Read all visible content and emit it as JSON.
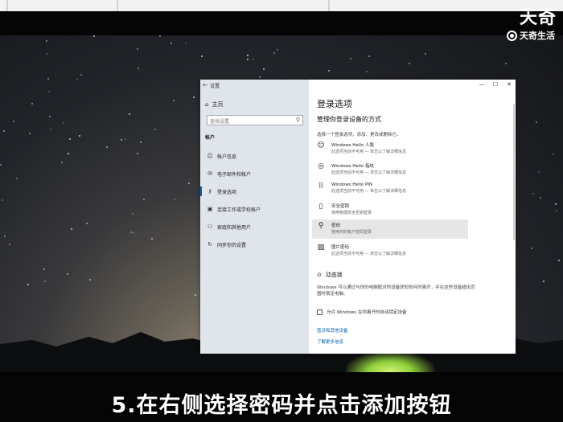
{
  "watermark": {
    "brand_large": "天奇",
    "brand_small": "天奇生活"
  },
  "window": {
    "title": "设置",
    "controls": {
      "minimize": "—",
      "maximize": "☐",
      "close": "✕"
    }
  },
  "sidebar": {
    "home_label": "主页",
    "search_placeholder": "查找设置",
    "section_title": "帐户",
    "items": [
      {
        "label": "帐户信息",
        "icon": "person-icon"
      },
      {
        "label": "电子邮件和帐户",
        "icon": "mail-icon"
      },
      {
        "label": "登录选项",
        "icon": "key-icon",
        "active": true
      },
      {
        "label": "连接工作或学校帐户",
        "icon": "briefcase-icon"
      },
      {
        "label": "家庭和其他用户",
        "icon": "people-icon"
      },
      {
        "label": "同步你的设置",
        "icon": "sync-icon"
      }
    ]
  },
  "content": {
    "title": "登录选项",
    "subtitle": "管理你登录设备的方式",
    "hint": "选择一个登录选项，添加、更改或删除它。",
    "options": [
      {
        "name": "Windows Hello 人脸",
        "desc": "此选项当前不可用 — 单击以了解详细信息",
        "icon": "face-icon"
      },
      {
        "name": "Windows Hello 指纹",
        "desc": "此选项当前不可用 — 单击以了解详细信息",
        "icon": "fingerprint-icon"
      },
      {
        "name": "Windows Hello PIN",
        "desc": "此选项当前不可用 — 单击以了解详细信息",
        "icon": "pin-keypad-icon"
      },
      {
        "name": "安全密钥",
        "desc": "使用物理安全密钥登录",
        "icon": "usb-key-icon"
      },
      {
        "name": "密码",
        "desc": "使用你的帐户密码登录",
        "icon": "password-key-icon",
        "selected": true
      },
      {
        "name": "图片密码",
        "desc": "此选项当前不可用 — 单击以了解详细信息",
        "icon": "picture-icon"
      }
    ],
    "dynamic_lock": {
      "title": "动态锁",
      "desc": "Windows 可以通过与你的电脑配对的设备获知你何时离开，并在这些设备超出范围时锁定电脑。",
      "checkbox_label": "允许 Windows 在你离开时自动锁定设备"
    },
    "links": [
      "蓝牙和其他设备",
      "了解更多信息"
    ]
  },
  "caption": "5.在右侧选择密码并点击添加按钮"
}
